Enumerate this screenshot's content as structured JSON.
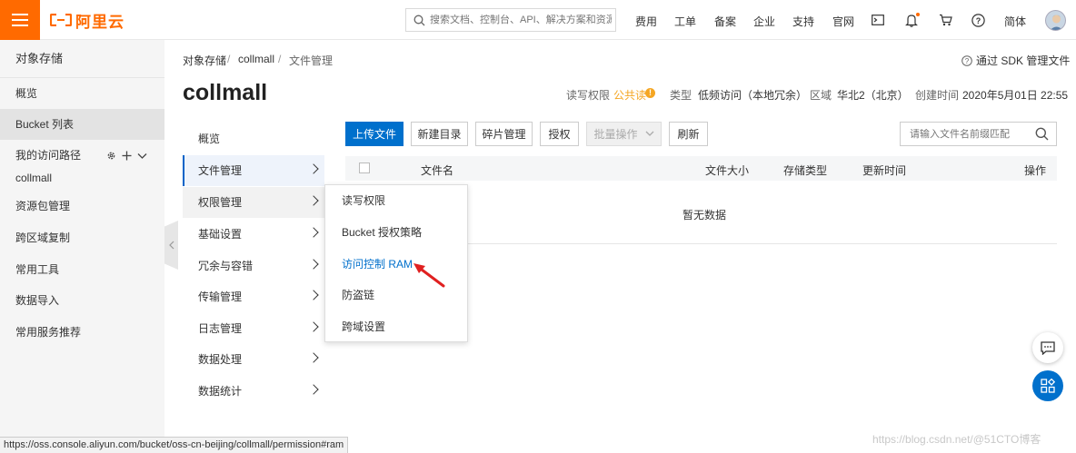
{
  "header": {
    "logo_text": "阿里云",
    "search_placeholder": "搜索文档、控制台、API、解决方案和资源",
    "nav": [
      "费用",
      "工单",
      "备案",
      "企业",
      "支持",
      "官网"
    ],
    "language": "简体",
    "brand_color": "#ff6a00"
  },
  "sidebar": {
    "title": "对象存储",
    "items": [
      "概览",
      "Bucket 列表",
      "我的访问路径",
      "collmall",
      "资源包管理",
      "跨区域复制",
      "常用工具",
      "数据导入",
      "常用服务推荐"
    ]
  },
  "breadcrumb": {
    "items": [
      "对象存储",
      "collmall",
      "文件管理"
    ],
    "separator": "/"
  },
  "sdk_link": "通过 SDK 管理文件",
  "bucket": {
    "name": "collmall",
    "acl_label": "读写权限",
    "acl_value": "公共读",
    "type_label": "类型",
    "type_value": "低频访问（本地冗余）",
    "region_label": "区域",
    "region_value": "华北2（北京）",
    "created_label": "创建时间",
    "created_value": "2020年5月01日 22:55"
  },
  "subnav": [
    "概览",
    "文件管理",
    "权限管理",
    "基础设置",
    "冗余与容错",
    "传输管理",
    "日志管理",
    "数据处理",
    "数据统计"
  ],
  "toolbar": {
    "upload": "上传文件",
    "new_dir": "新建目录",
    "fragments": "碎片管理",
    "authorize": "授权",
    "batch": "批量操作",
    "refresh": "刷新",
    "search_placeholder": "请输入文件名前缀匹配"
  },
  "table": {
    "columns": [
      "文件名",
      "文件大小",
      "存储类型",
      "更新时间",
      "操作"
    ],
    "empty_text": "暂无数据"
  },
  "dropdown": {
    "items": [
      "读写权限",
      "Bucket 授权策略",
      "访问控制 RAM",
      "防盗链",
      "跨域设置"
    ]
  },
  "statusbar_url": "https://oss.console.aliyun.com/bucket/oss-cn-beijing/collmall/permission#ram",
  "watermark": "https://blog.csdn.net/@51CTO博客",
  "colors": {
    "primary": "#0070cc",
    "accent": "#ff6a00",
    "warning": "#f5a623",
    "arrow": "#e02020"
  }
}
